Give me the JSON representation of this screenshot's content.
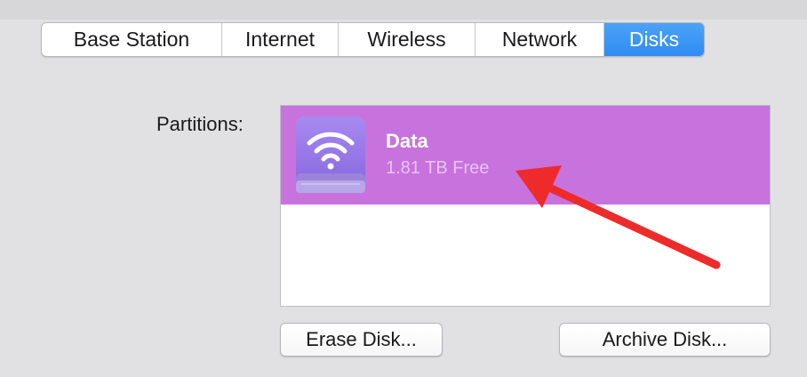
{
  "tabs": [
    {
      "label": "Base Station",
      "selected": false
    },
    {
      "label": "Internet",
      "selected": false
    },
    {
      "label": "Wireless",
      "selected": false
    },
    {
      "label": "Network",
      "selected": false
    },
    {
      "label": "Disks",
      "selected": true
    }
  ],
  "partitions": {
    "label": "Partitions:",
    "items": [
      {
        "name": "Data",
        "free": "1.81 TB Free",
        "icon": "wifi-disk-icon",
        "selected": true
      }
    ]
  },
  "buttons": {
    "erase": "Erase Disk...",
    "archive": "Archive Disk..."
  },
  "colors": {
    "selected_tab": "#3a96f3",
    "selected_partition": "#c872de",
    "annotation_arrow": "#ee2b2b"
  }
}
